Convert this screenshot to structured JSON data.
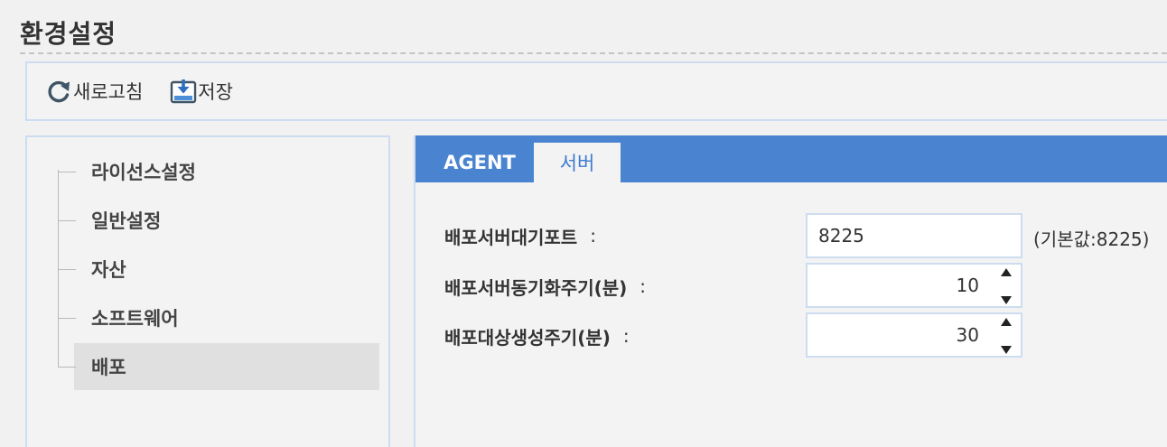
{
  "page": {
    "title": "환경설정"
  },
  "toolbar": {
    "refresh_label": "새로고침",
    "save_label": "저장"
  },
  "tree": {
    "items": [
      {
        "label": "라이선스설정",
        "selected": false
      },
      {
        "label": "일반설정",
        "selected": false
      },
      {
        "label": "자산",
        "selected": false
      },
      {
        "label": "소프트웨어",
        "selected": false
      },
      {
        "label": "배포",
        "selected": true
      }
    ]
  },
  "tabs": [
    {
      "label": "AGENT",
      "active": false
    },
    {
      "label": "서버",
      "active": true
    }
  ],
  "form": {
    "port": {
      "label": "배포서버대기포트",
      "colon": ":",
      "value": "8225",
      "hint": "(기본값:8225)"
    },
    "sync_interval": {
      "label": "배포서버동기화주기(분)",
      "colon": ":",
      "value": "10"
    },
    "target_interval": {
      "label": "배포대상생성주기(분)",
      "colon": ":",
      "value": "30"
    }
  },
  "colors": {
    "accent": "#4a84d0",
    "active_tab_text": "#3c7bd0",
    "panel_border": "#cddcf0",
    "selected_item_bg": "#e0e0e0"
  },
  "icons": {
    "refresh": "refresh-icon",
    "save": "save-icon",
    "spin_up": "arrow-up-icon",
    "spin_down": "arrow-down-icon"
  }
}
